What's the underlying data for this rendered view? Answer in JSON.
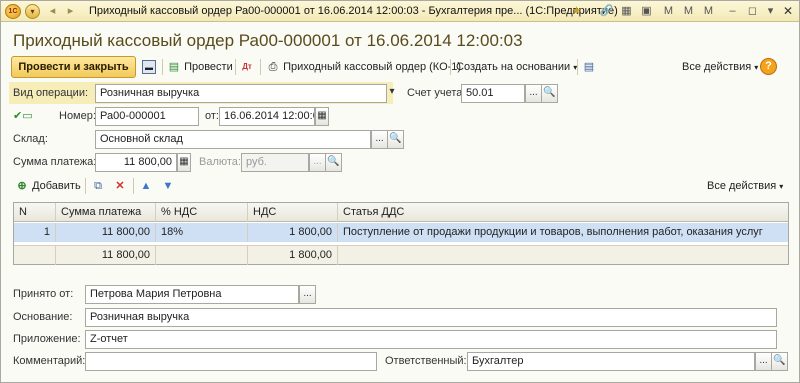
{
  "window": {
    "title": "Приходный кассовый ордер Ра00-000001 от 16.06.2014 12:00:03 - Бухгалтерия пре... (1С:Предприятие)",
    "logo_text": "1С"
  },
  "document": {
    "title": "Приходный кассовый ордер Ра00-000001 от 16.06.2014 12:00:03"
  },
  "toolbar": {
    "post_and_close": "Провести и закрыть",
    "post": "Провести",
    "print_form": "Приходный кассовый ордер (КО-1)",
    "create_based_on": "Создать на основании",
    "all_actions": "Все действия"
  },
  "form": {
    "operation_type_label": "Вид операции:",
    "operation_type_value": "Розничная выручка",
    "account_label": "Счет учета:",
    "account_value": "50.01",
    "number_label": "Номер:",
    "number_value": "Ра00-000001",
    "date_label": "от:",
    "date_value": "16.06.2014 12:00:03",
    "warehouse_label": "Склад:",
    "warehouse_value": "Основной склад",
    "amount_label": "Сумма платежа:",
    "amount_value": "11 800,00",
    "currency_label": "Валюта:",
    "currency_value": "руб."
  },
  "table_toolbar": {
    "add": "Добавить",
    "all_actions": "Все действия"
  },
  "table": {
    "columns": [
      "N",
      "Сумма платежа",
      "% НДС",
      "НДС",
      "Статья ДДС"
    ],
    "rows": [
      {
        "n": "1",
        "amount": "11 800,00",
        "vat_rate": "18%",
        "vat": "1 800,00",
        "cashflow_item": "Поступление от продажи продукции и товаров, выполнения работ, оказания услуг"
      }
    ],
    "totals": {
      "amount": "11 800,00",
      "vat": "1 800,00"
    }
  },
  "footer": {
    "received_from_label": "Принято от:",
    "received_from_value": "Петрова Мария Петровна",
    "basis_label": "Основание:",
    "basis_value": "Розничная выручка",
    "attachment_label": "Приложение:",
    "attachment_value": "Z-отчет",
    "comment_label": "Комментарий:",
    "comment_value": "",
    "responsible_label": "Ответственный:",
    "responsible_value": "Бухгалтер"
  }
}
